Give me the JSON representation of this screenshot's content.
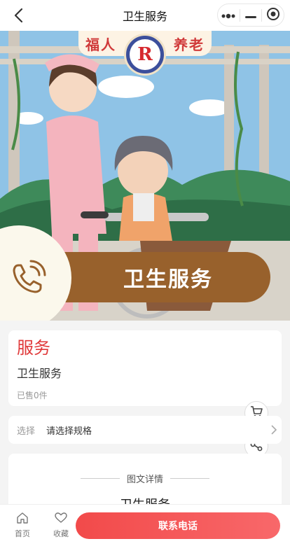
{
  "nav": {
    "title": "卫生服务"
  },
  "hero": {
    "badge_left": "福人",
    "badge_right": "养老",
    "logo_letter": "R",
    "banner_text": "卫生服务"
  },
  "product": {
    "price_label": "服务",
    "name": "卫生服务",
    "sold": "已售0件"
  },
  "spec": {
    "label": "选择",
    "value": "请选择规格"
  },
  "detail": {
    "header": "图文详情",
    "title": "卫生服务"
  },
  "bottom_bar": {
    "home_label": "首页",
    "favorite_label": "收藏",
    "contact_label": "联系电话"
  },
  "colors": {
    "accent": "#e0393a",
    "banner": "#98612c",
    "cta_start": "#f24a4a",
    "cta_end": "#f8686a"
  }
}
